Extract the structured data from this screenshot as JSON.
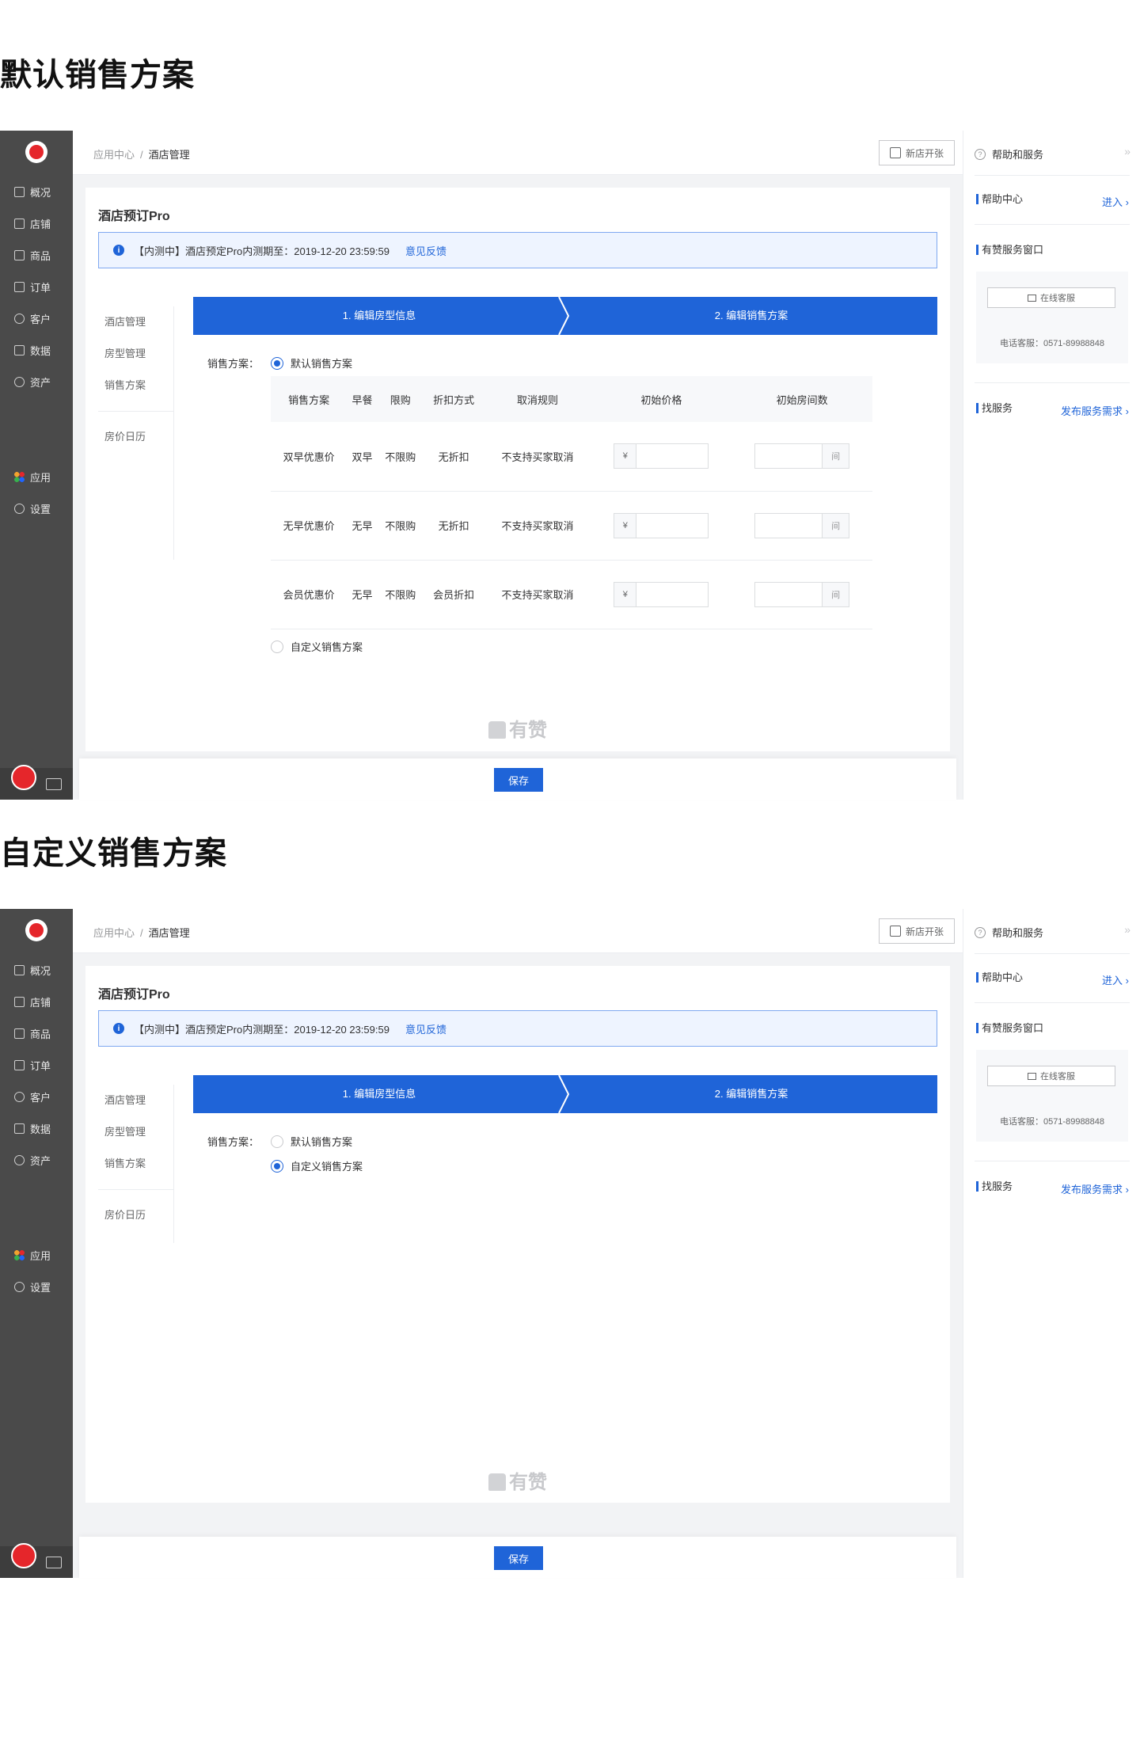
{
  "sections": [
    {
      "title": "默认销售方案"
    },
    {
      "title": "自定义销售方案"
    }
  ],
  "nav": {
    "items": [
      {
        "label": "概况",
        "icon": "monitor-icon"
      },
      {
        "label": "店铺",
        "icon": "store-icon"
      },
      {
        "label": "商品",
        "icon": "tag-icon"
      },
      {
        "label": "订单",
        "icon": "order-icon"
      },
      {
        "label": "客户",
        "icon": "user-icon"
      },
      {
        "label": "数据",
        "icon": "chart-icon"
      },
      {
        "label": "资产",
        "icon": "yen-icon"
      }
    ],
    "apps": {
      "label": "应用",
      "icon": "apps-icon"
    },
    "settings": {
      "label": "设置",
      "icon": "gear-icon"
    }
  },
  "topbar": {
    "crumb_root": "应用中心",
    "crumb_sep": "/",
    "crumb_current": "酒店管理",
    "new_shop": "新店开张"
  },
  "card": {
    "title": "酒店预订Pro",
    "notice": "【内测中】酒店预定Pro内测期至：2019-12-20 23:59:59",
    "notice_link": "意见反馈",
    "subnav": [
      "酒店管理",
      "房型管理",
      "销售方案",
      "房价日历"
    ],
    "steps": [
      "1. 编辑房型信息",
      "2. 编辑销售方案"
    ],
    "plan_label": "销售方案：",
    "option_default": "默认销售方案",
    "option_custom": "自定义销售方案"
  },
  "table": {
    "headers": [
      "销售方案",
      "早餐",
      "限购",
      "折扣方式",
      "取消规则",
      "初始价格",
      "初始房间数"
    ],
    "rows": [
      [
        "双早优惠价",
        "双早",
        "不限购",
        "无折扣",
        "不支持买家取消"
      ],
      [
        "无早优惠价",
        "无早",
        "不限购",
        "无折扣",
        "不支持买家取消"
      ],
      [
        "会员优惠价",
        "无早",
        "不限购",
        "会员折扣",
        "不支持买家取消"
      ]
    ],
    "price_prefix": "¥",
    "rooms_suffix": "间"
  },
  "brand": "有赞",
  "save": "保存",
  "side": {
    "title": "帮助和服务",
    "collapse": "»",
    "help_center": "帮助中心",
    "enter": "进入 ›",
    "service_window": "有赞服务窗口",
    "online_service": "在线客服",
    "phone": "电话客服：0571-89988848",
    "find_service": "找服务",
    "publish": "发布服务需求 ›"
  },
  "colors": {
    "primary": "#1f64d8",
    "nav_bg": "#4a4a4a",
    "brand_red": "#e5262b"
  }
}
